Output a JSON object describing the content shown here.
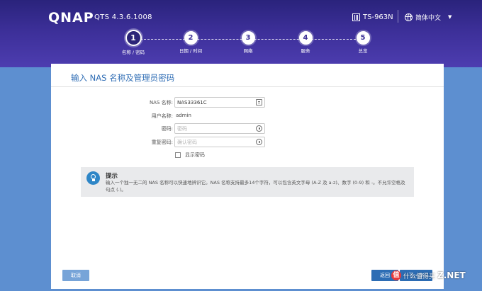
{
  "header": {
    "logo": "QNAP",
    "version": "QTS 4.3.6.1008",
    "model": "TS-963N",
    "language": "简体中文"
  },
  "steps": [
    {
      "number": "1",
      "label": "名称 / 密码",
      "active": true
    },
    {
      "number": "2",
      "label": "日期 / 时间",
      "active": false
    },
    {
      "number": "3",
      "label": "网络",
      "active": false
    },
    {
      "number": "4",
      "label": "服务",
      "active": false
    },
    {
      "number": "5",
      "label": "总览",
      "active": false
    }
  ],
  "form": {
    "title": "输入 NAS 名称及管理员密码",
    "nas_name_label": "NAS 名称:",
    "nas_name_value": "NAS33361C",
    "username_label": "用户名称:",
    "username_value": "admin",
    "password_label": "密码:",
    "password_placeholder": "密码",
    "confirm_label": "重复密码:",
    "confirm_placeholder": "确认密码",
    "show_password_label": "显示密码"
  },
  "tip": {
    "title": "提示",
    "text": "输入一个独一无二的 NAS 名称可以快速地辨识它。NAS 名称支持最多14个字符，可以包含英文字母 (A-Z 及 a-z)、数字 (0-9) 和 -。不允许空格及句点 (.)。"
  },
  "buttons": {
    "cancel": "取消",
    "back": "返回",
    "next": "下一步"
  },
  "watermark": {
    "badge": "值",
    "text": "什么值得买",
    "site": "Z.NET"
  },
  "colors": {
    "header": "#3c2f98",
    "accent": "#2d6db4",
    "tip_icon": "#2e86c7"
  }
}
